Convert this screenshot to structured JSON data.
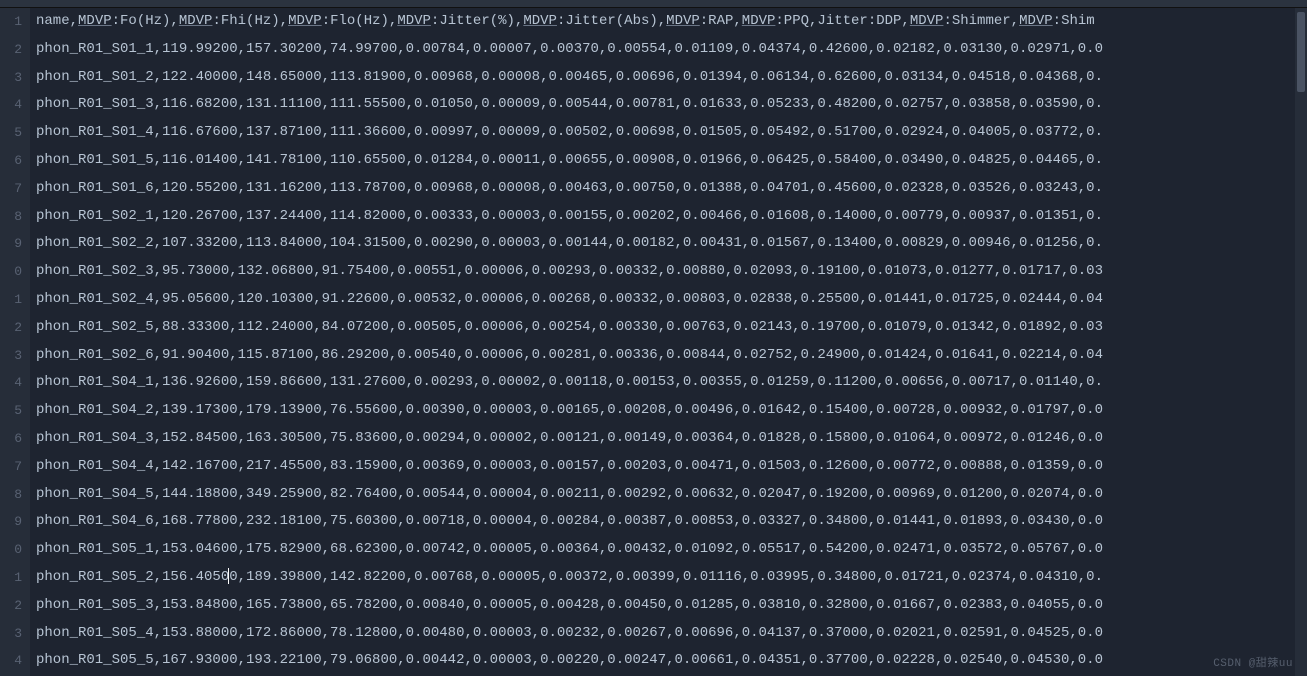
{
  "gutter": {
    "start": 1,
    "count": 24
  },
  "header": {
    "prefix": "name,",
    "fields": [
      {
        "u": "MDVP",
        "t": ":Fo(Hz),"
      },
      {
        "u": "MDVP",
        "t": ":Fhi(Hz),"
      },
      {
        "u": "MDVP",
        "t": ":Flo(Hz),"
      },
      {
        "u": "MDVP",
        "t": ":Jitter(%),"
      },
      {
        "u": "MDVP",
        "t": ":Jitter(Abs),"
      },
      {
        "u": "MDVP",
        "t": ":RAP,"
      },
      {
        "u": "MDVP",
        "t": ":PPQ,Jitter:DDP,"
      },
      {
        "u": "MDVP",
        "t": ":Shimmer,"
      },
      {
        "u": "MDVP",
        "t": ":Shim"
      }
    ]
  },
  "rows": [
    "phon_R01_S01_1,119.99200,157.30200,74.99700,0.00784,0.00007,0.00370,0.00554,0.01109,0.04374,0.42600,0.02182,0.03130,0.02971,0.0",
    "phon_R01_S01_2,122.40000,148.65000,113.81900,0.00968,0.00008,0.00465,0.00696,0.01394,0.06134,0.62600,0.03134,0.04518,0.04368,0.",
    "phon_R01_S01_3,116.68200,131.11100,111.55500,0.01050,0.00009,0.00544,0.00781,0.01633,0.05233,0.48200,0.02757,0.03858,0.03590,0.",
    "phon_R01_S01_4,116.67600,137.87100,111.36600,0.00997,0.00009,0.00502,0.00698,0.01505,0.05492,0.51700,0.02924,0.04005,0.03772,0.",
    "phon_R01_S01_5,116.01400,141.78100,110.65500,0.01284,0.00011,0.00655,0.00908,0.01966,0.06425,0.58400,0.03490,0.04825,0.04465,0.",
    "phon_R01_S01_6,120.55200,131.16200,113.78700,0.00968,0.00008,0.00463,0.00750,0.01388,0.04701,0.45600,0.02328,0.03526,0.03243,0.",
    "phon_R01_S02_1,120.26700,137.24400,114.82000,0.00333,0.00003,0.00155,0.00202,0.00466,0.01608,0.14000,0.00779,0.00937,0.01351,0.",
    "phon_R01_S02_2,107.33200,113.84000,104.31500,0.00290,0.00003,0.00144,0.00182,0.00431,0.01567,0.13400,0.00829,0.00946,0.01256,0.",
    "phon_R01_S02_3,95.73000,132.06800,91.75400,0.00551,0.00006,0.00293,0.00332,0.00880,0.02093,0.19100,0.01073,0.01277,0.01717,0.03",
    "phon_R01_S02_4,95.05600,120.10300,91.22600,0.00532,0.00006,0.00268,0.00332,0.00803,0.02838,0.25500,0.01441,0.01725,0.02444,0.04",
    "phon_R01_S02_5,88.33300,112.24000,84.07200,0.00505,0.00006,0.00254,0.00330,0.00763,0.02143,0.19700,0.01079,0.01342,0.01892,0.03",
    "phon_R01_S02_6,91.90400,115.87100,86.29200,0.00540,0.00006,0.00281,0.00336,0.00844,0.02752,0.24900,0.01424,0.01641,0.02214,0.04",
    "phon_R01_S04_1,136.92600,159.86600,131.27600,0.00293,0.00002,0.00118,0.00153,0.00355,0.01259,0.11200,0.00656,0.00717,0.01140,0.",
    "phon_R01_S04_2,139.17300,179.13900,76.55600,0.00390,0.00003,0.00165,0.00208,0.00496,0.01642,0.15400,0.00728,0.00932,0.01797,0.0",
    "phon_R01_S04_3,152.84500,163.30500,75.83600,0.00294,0.00002,0.00121,0.00149,0.00364,0.01828,0.15800,0.01064,0.00972,0.01246,0.0",
    "phon_R01_S04_4,142.16700,217.45500,83.15900,0.00369,0.00003,0.00157,0.00203,0.00471,0.01503,0.12600,0.00772,0.00888,0.01359,0.0",
    "phon_R01_S04_5,144.18800,349.25900,82.76400,0.00544,0.00004,0.00211,0.00292,0.00632,0.02047,0.19200,0.00969,0.01200,0.02074,0.0",
    "phon_R01_S04_6,168.77800,232.18100,75.60300,0.00718,0.00004,0.00284,0.00387,0.00853,0.03327,0.34800,0.01441,0.01893,0.03430,0.0",
    "phon_R01_S05_1,153.04600,175.82900,68.62300,0.00742,0.00005,0.00364,0.00432,0.01092,0.05517,0.54200,0.02471,0.03572,0.05767,0.0",
    "phon_R01_S05_2,156.40500,189.39800,142.82200,0.00768,0.00005,0.00372,0.00399,0.01116,0.03995,0.34800,0.01721,0.02374,0.04310,0.",
    "phon_R01_S05_3,153.84800,165.73800,65.78200,0.00840,0.00005,0.00428,0.00450,0.01285,0.03810,0.32800,0.01667,0.02383,0.04055,0.0",
    "phon_R01_S05_4,153.88000,172.86000,78.12800,0.00480,0.00003,0.00232,0.00267,0.00696,0.04137,0.37000,0.02021,0.02591,0.04525,0.0",
    "phon_R01_S05_5,167.93000,193.22100,79.06800,0.00442,0.00003,0.00220,0.00247,0.00661,0.04351,0.37700,0.02228,0.02540,0.04530,0.0"
  ],
  "bulb_row_index": 18,
  "caret_row_index": 19,
  "caret_after_chars": 23,
  "watermark": "CSDN @甜辣uu"
}
